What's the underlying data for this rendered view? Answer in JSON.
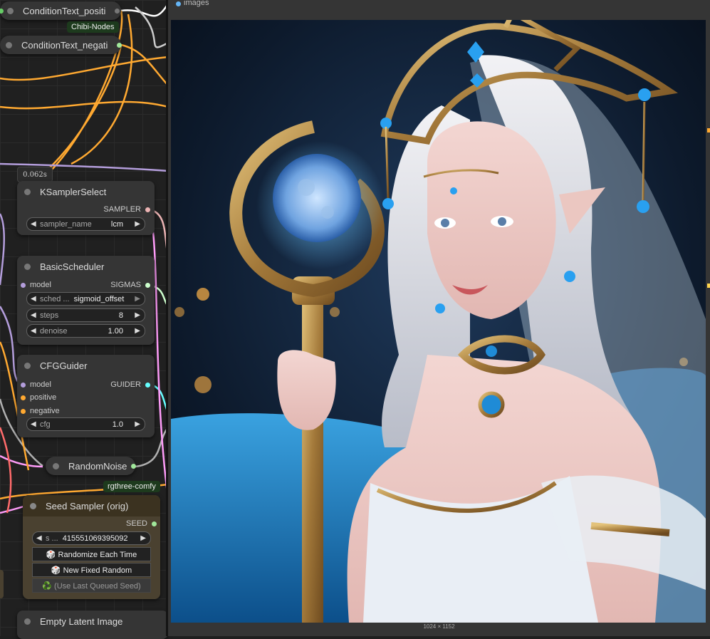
{
  "nodes": {
    "cond_pos": {
      "title": "ConditionText_positi"
    },
    "cond_neg": {
      "title": "ConditionText_negati"
    },
    "chibi_badge": "Chibi-Nodes",
    "timing": "0.062s",
    "ksampler_select": {
      "title": "KSamplerSelect",
      "output": "SAMPLER",
      "widget_label": "sampler_name",
      "widget_value": "lcm"
    },
    "basic_scheduler": {
      "title": "BasicScheduler",
      "input": "model",
      "output": "SIGMAS",
      "widgets": [
        {
          "label": "sched ...",
          "value": "sigmoid_offset"
        },
        {
          "label": "steps",
          "value": "8"
        },
        {
          "label": "denoise",
          "value": "1.00"
        }
      ]
    },
    "cfg_guider": {
      "title": "CFGGuider",
      "inputs": [
        "model",
        "positive",
        "negative"
      ],
      "output": "GUIDER",
      "widget_label": "cfg",
      "widget_value": "1.0"
    },
    "random_noise": {
      "title": "RandomNoise"
    },
    "rgthree_badge": "rgthree-comfy",
    "seed_sampler": {
      "title": "Seed Sampler (orig)",
      "output": "SEED",
      "widget_label": "s ...",
      "widget_value": "415551069395092",
      "buttons": [
        "🎲 Randomize Each Time",
        "🎲 New Fixed Random",
        "♻️ (Use Last Queued Seed)"
      ]
    },
    "empty_latent": {
      "title": "Empty Latent Image"
    }
  },
  "preview": {
    "label": "images",
    "caption": "1024 × 1152"
  },
  "colors": {
    "sampler": "#ecb4b4",
    "sigmas": "#cdffcd",
    "model": "#b39ddb",
    "conditioning": "#ffa931",
    "guider": "#66ffff",
    "noise": "#b0b0b0",
    "int": "#a1e89b",
    "latent": "#ff9cf9",
    "seed_node_bg": "#4a4130"
  }
}
